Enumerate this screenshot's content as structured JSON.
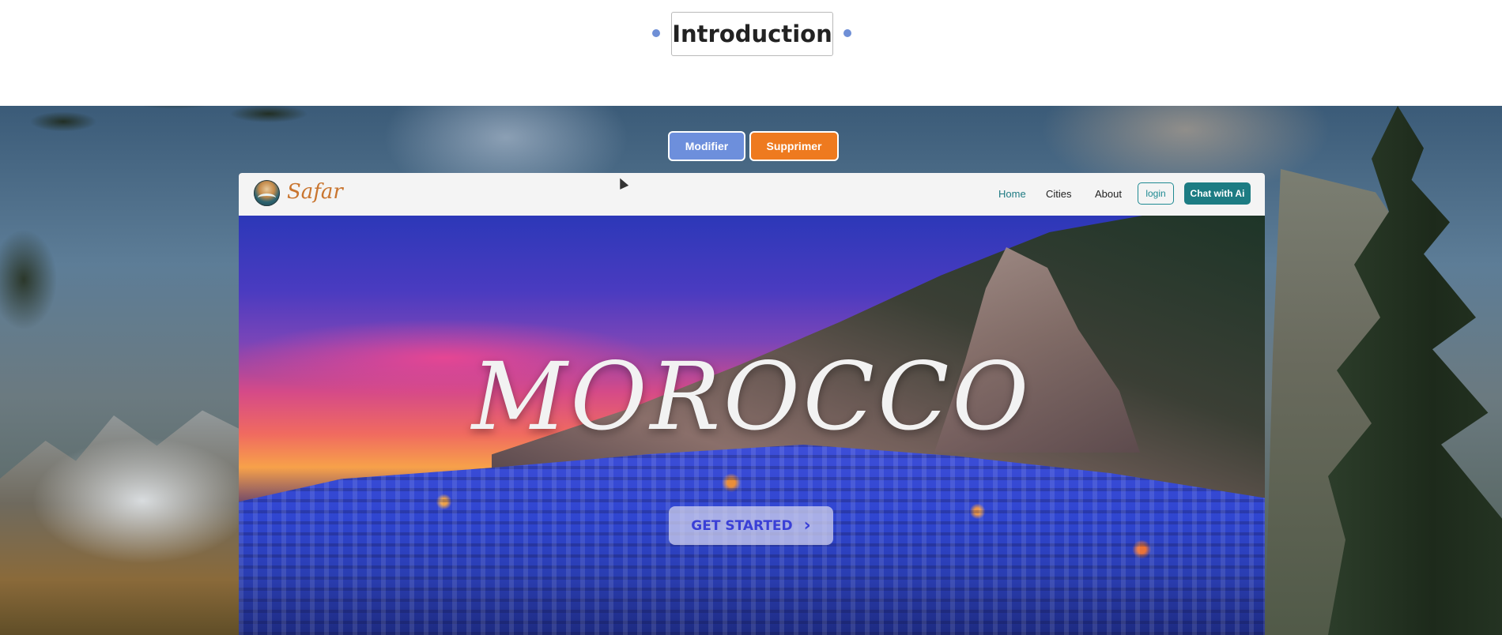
{
  "intro": {
    "title": "Introduction"
  },
  "admin_buttons": {
    "modifier": "Modifier",
    "supprimer": "Supprimer"
  },
  "site": {
    "logo_text": "Safar",
    "nav": {
      "home": "Home",
      "cities": "Cities",
      "about": "About",
      "login": "login",
      "chat": "Chat with Ai"
    },
    "hero": {
      "title": "MOROCCO",
      "cta": "GET STARTED",
      "cta_icon": "chevron-right-icon"
    }
  },
  "colors": {
    "accent_blue": "#6d8fdc",
    "accent_orange": "#ee7a1f",
    "teal": "#1d7c83",
    "logo_brown": "#c9752f"
  }
}
